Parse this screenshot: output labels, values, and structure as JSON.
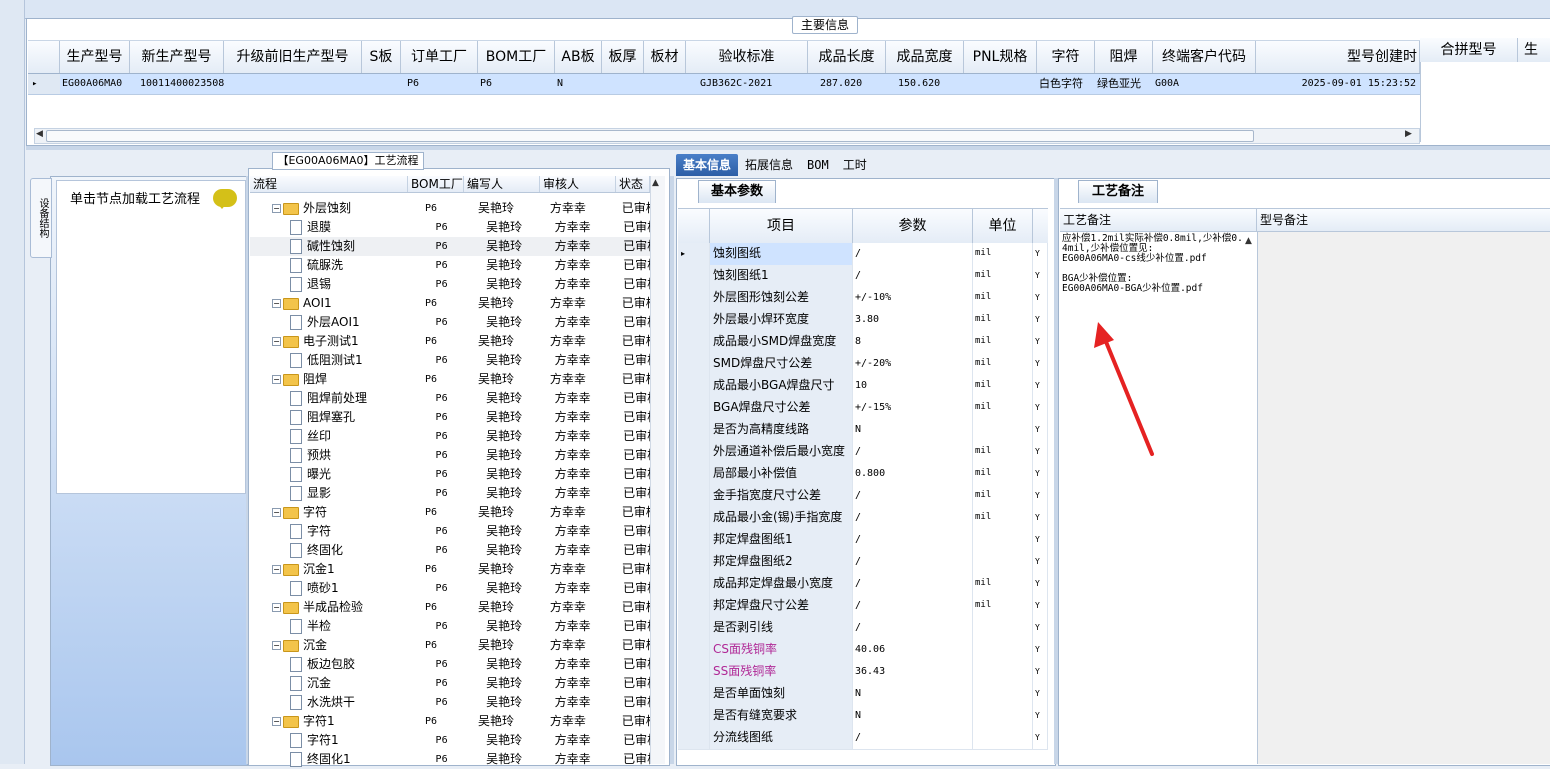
{
  "main_info": {
    "legend": "主要信息",
    "columns": [
      "生产型号",
      "新生产型号",
      "升级前旧生产型号",
      "S板",
      "订单工厂",
      "BOM工厂",
      "AB板",
      "板厚",
      "板材",
      "验收标准",
      "成品长度",
      "成品宽度",
      "PNL规格",
      "字符",
      "阻焊",
      "终端客户代码",
      "型号创建时"
    ],
    "extra_columns": [
      "合拼型号",
      "生"
    ],
    "row": [
      "EG00A06MA0",
      "10011400023508",
      "",
      "",
      "P6",
      "P6",
      "N",
      "",
      "",
      "GJB362C-2021",
      "287.020",
      "150.620",
      "",
      "白色字符",
      "绿色亚光",
      "G00A",
      "2025-09-01 15:23:52"
    ],
    "row_marker": "▸"
  },
  "side": {
    "vertical_tab": "设备结构",
    "hint": "单击节点加载工艺流程"
  },
  "process": {
    "title": "【EG00A06MA0】工艺流程",
    "headers": [
      "流程",
      "BOM工厂",
      "编写人",
      "审核人",
      "状态"
    ],
    "rows": [
      {
        "name": "外层蚀刻",
        "type": "folder",
        "level": 1,
        "bom": "P6",
        "author": "吴艳玲",
        "reviewer": "方幸幸",
        "status": "已审核"
      },
      {
        "name": "退膜",
        "type": "doc",
        "level": 2,
        "bom": "P6",
        "author": "吴艳玲",
        "reviewer": "方幸幸",
        "status": "已审核"
      },
      {
        "name": "碱性蚀刻",
        "type": "doc",
        "level": 2,
        "bom": "P6",
        "author": "吴艳玲",
        "reviewer": "方幸幸",
        "status": "已审核",
        "selected": true
      },
      {
        "name": "硫脲洗",
        "type": "doc",
        "level": 2,
        "bom": "P6",
        "author": "吴艳玲",
        "reviewer": "方幸幸",
        "status": "已审核"
      },
      {
        "name": "退锡",
        "type": "doc",
        "level": 2,
        "bom": "P6",
        "author": "吴艳玲",
        "reviewer": "方幸幸",
        "status": "已审核"
      },
      {
        "name": "AOI1",
        "type": "folder",
        "level": 1,
        "bom": "P6",
        "author": "吴艳玲",
        "reviewer": "方幸幸",
        "status": "已审核"
      },
      {
        "name": "外层AOI1",
        "type": "doc",
        "level": 2,
        "bom": "P6",
        "author": "吴艳玲",
        "reviewer": "方幸幸",
        "status": "已审核"
      },
      {
        "name": "电子测试1",
        "type": "folder",
        "level": 1,
        "bom": "P6",
        "author": "吴艳玲",
        "reviewer": "方幸幸",
        "status": "已审核"
      },
      {
        "name": "低阻测试1",
        "type": "doc",
        "level": 2,
        "bom": "P6",
        "author": "吴艳玲",
        "reviewer": "方幸幸",
        "status": "已审核"
      },
      {
        "name": "阻焊",
        "type": "folder",
        "level": 1,
        "bom": "P6",
        "author": "吴艳玲",
        "reviewer": "方幸幸",
        "status": "已审核"
      },
      {
        "name": "阻焊前处理",
        "type": "doc",
        "level": 2,
        "bom": "P6",
        "author": "吴艳玲",
        "reviewer": "方幸幸",
        "status": "已审核"
      },
      {
        "name": "阻焊塞孔",
        "type": "doc",
        "level": 2,
        "bom": "P6",
        "author": "吴艳玲",
        "reviewer": "方幸幸",
        "status": "已审核"
      },
      {
        "name": "丝印",
        "type": "doc",
        "level": 2,
        "bom": "P6",
        "author": "吴艳玲",
        "reviewer": "方幸幸",
        "status": "已审核"
      },
      {
        "name": "预烘",
        "type": "doc",
        "level": 2,
        "bom": "P6",
        "author": "吴艳玲",
        "reviewer": "方幸幸",
        "status": "已审核"
      },
      {
        "name": "曝光",
        "type": "doc",
        "level": 2,
        "bom": "P6",
        "author": "吴艳玲",
        "reviewer": "方幸幸",
        "status": "已审核"
      },
      {
        "name": "显影",
        "type": "doc",
        "level": 2,
        "bom": "P6",
        "author": "吴艳玲",
        "reviewer": "方幸幸",
        "status": "已审核"
      },
      {
        "name": "字符",
        "type": "folder",
        "level": 1,
        "bom": "P6",
        "author": "吴艳玲",
        "reviewer": "方幸幸",
        "status": "已审核"
      },
      {
        "name": "字符",
        "type": "doc",
        "level": 2,
        "bom": "P6",
        "author": "吴艳玲",
        "reviewer": "方幸幸",
        "status": "已审核"
      },
      {
        "name": "终固化",
        "type": "doc",
        "level": 2,
        "bom": "P6",
        "author": "吴艳玲",
        "reviewer": "方幸幸",
        "status": "已审核"
      },
      {
        "name": "沉金1",
        "type": "folder",
        "level": 1,
        "bom": "P6",
        "author": "吴艳玲",
        "reviewer": "方幸幸",
        "status": "已审核"
      },
      {
        "name": "喷砂1",
        "type": "doc",
        "level": 2,
        "bom": "P6",
        "author": "吴艳玲",
        "reviewer": "方幸幸",
        "status": "已审核"
      },
      {
        "name": "半成品检验",
        "type": "folder",
        "level": 1,
        "bom": "P6",
        "author": "吴艳玲",
        "reviewer": "方幸幸",
        "status": "已审核"
      },
      {
        "name": "半检",
        "type": "doc",
        "level": 2,
        "bom": "P6",
        "author": "吴艳玲",
        "reviewer": "方幸幸",
        "status": "已审核"
      },
      {
        "name": "沉金",
        "type": "folder",
        "level": 1,
        "bom": "P6",
        "author": "吴艳玲",
        "reviewer": "方幸幸",
        "status": "已审核"
      },
      {
        "name": "板边包胶",
        "type": "doc",
        "level": 2,
        "bom": "P6",
        "author": "吴艳玲",
        "reviewer": "方幸幸",
        "status": "已审核"
      },
      {
        "name": "沉金",
        "type": "doc",
        "level": 2,
        "bom": "P6",
        "author": "吴艳玲",
        "reviewer": "方幸幸",
        "status": "已审核"
      },
      {
        "name": "水洗烘干",
        "type": "doc",
        "level": 2,
        "bom": "P6",
        "author": "吴艳玲",
        "reviewer": "方幸幸",
        "status": "已审核"
      },
      {
        "name": "字符1",
        "type": "folder",
        "level": 1,
        "bom": "P6",
        "author": "吴艳玲",
        "reviewer": "方幸幸",
        "status": "已审核"
      },
      {
        "name": "字符1",
        "type": "doc",
        "level": 2,
        "bom": "P6",
        "author": "吴艳玲",
        "reviewer": "方幸幸",
        "status": "已审核"
      },
      {
        "name": "终固化1",
        "type": "doc",
        "level": 2,
        "bom": "P6",
        "author": "吴艳玲",
        "reviewer": "方幸幸",
        "status": "已审核"
      }
    ]
  },
  "tabs": [
    "基本信息",
    "拓展信息",
    "BOM",
    "工时"
  ],
  "basic": {
    "caption": "基本参数",
    "headers": [
      "项目",
      "参数",
      "单位"
    ],
    "rows": [
      {
        "item": "蚀刻图纸",
        "value": "/",
        "unit": "mil",
        "flag": "Y",
        "current": true
      },
      {
        "item": "蚀刻图纸1",
        "value": "/",
        "unit": "mil",
        "flag": "Y"
      },
      {
        "item": "外层图形蚀刻公差",
        "value": "+/-10%",
        "unit": "mil",
        "flag": "Y"
      },
      {
        "item": "外层最小焊环宽度",
        "value": "3.80",
        "unit": "mil",
        "flag": "Y"
      },
      {
        "item": "成品最小SMD焊盘宽度",
        "value": "8",
        "unit": "mil",
        "flag": "Y"
      },
      {
        "item": "SMD焊盘尺寸公差",
        "value": "+/-20%",
        "unit": "mil",
        "flag": "Y"
      },
      {
        "item": "成品最小BGA焊盘尺寸",
        "value": "10",
        "unit": "mil",
        "flag": "Y"
      },
      {
        "item": "BGA焊盘尺寸公差",
        "value": "+/-15%",
        "unit": "mil",
        "flag": "Y"
      },
      {
        "item": "是否为高精度线路",
        "value": "N",
        "unit": "",
        "flag": "Y"
      },
      {
        "item": "外层通道补偿后最小宽度",
        "value": "/",
        "unit": "mil",
        "flag": "Y"
      },
      {
        "item": "局部最小补偿值",
        "value": "0.800",
        "unit": "mil",
        "flag": "Y"
      },
      {
        "item": "金手指宽度尺寸公差",
        "value": "/",
        "unit": "mil",
        "flag": "Y"
      },
      {
        "item": "成品最小金(锡)手指宽度",
        "value": "/",
        "unit": "mil",
        "flag": "Y"
      },
      {
        "item": "邦定焊盘图纸1",
        "value": "/",
        "unit": "",
        "flag": "Y"
      },
      {
        "item": "邦定焊盘图纸2",
        "value": "/",
        "unit": "",
        "flag": "Y"
      },
      {
        "item": "成品邦定焊盘最小宽度",
        "value": "/",
        "unit": "mil",
        "flag": "Y"
      },
      {
        "item": "邦定焊盘尺寸公差",
        "value": "/",
        "unit": "mil",
        "flag": "Y"
      },
      {
        "item": "是否剥引线",
        "value": "/",
        "unit": "",
        "flag": "Y"
      },
      {
        "item": "CS面残铜率",
        "value": "40.06",
        "unit": "",
        "flag": "Y",
        "purple": true
      },
      {
        "item": "SS面残铜率",
        "value": "36.43",
        "unit": "",
        "flag": "Y",
        "purple": true
      },
      {
        "item": "是否单面蚀刻",
        "value": "N",
        "unit": "",
        "flag": "Y"
      },
      {
        "item": "是否有缝宽要求",
        "value": "N",
        "unit": "",
        "flag": "Y"
      },
      {
        "item": "分流线图纸",
        "value": "/",
        "unit": "",
        "flag": "Y"
      }
    ]
  },
  "remark": {
    "caption": "工艺备注",
    "headers": [
      "工艺备注",
      "型号备注"
    ],
    "text": "应补偿1.2mil实际补偿0.8mil,少补偿0.4mil,少补偿位置见:\nEG00A06MA0-cs线少补位置.pdf\n\nBGA少补偿位置:\nEG00A06MA0-BGA少补位置.pdf"
  },
  "colors": {
    "selected_row": "#cfe3ff",
    "accent_tab": "#2c5ea6",
    "annotation_arrow": "#e52222",
    "purple_text": "#b02896"
  }
}
